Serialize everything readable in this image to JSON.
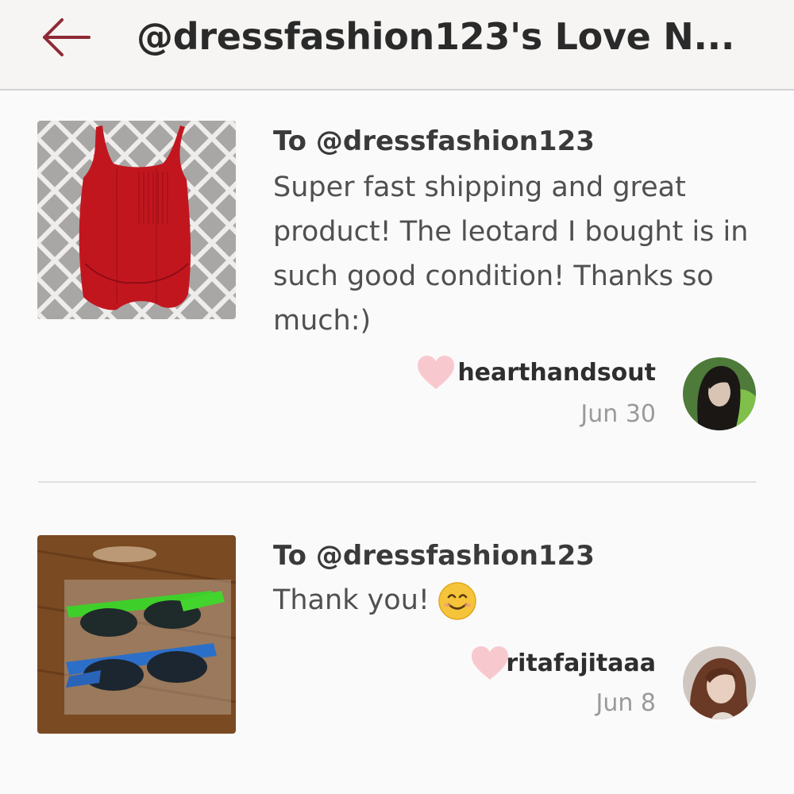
{
  "header": {
    "back_icon": "arrow-left-icon",
    "title": "@dressfashion123's Love N...",
    "accent_color": "#8e2a36"
  },
  "notes": [
    {
      "image": "red-leotard-photo",
      "recipient": "To @dressfashion123",
      "message": "Super fast shipping and great product! The leotard I bought is in such good condition! Thanks so much:)",
      "username": "hearthandsout",
      "date": "Jun 30",
      "heart_icon": "heart-icon"
    },
    {
      "image": "sunglasses-photo",
      "recipient": "To @dressfashion123",
      "message": "Thank you!",
      "emoji": "smiling-face-icon",
      "username": "ritafajitaaa",
      "date": "Jun 8",
      "heart_icon": "heart-icon"
    }
  ],
  "colors": {
    "heart": "#f7c9cf",
    "divider": "#e0dedd",
    "header_bg": "#f6f5f3"
  }
}
